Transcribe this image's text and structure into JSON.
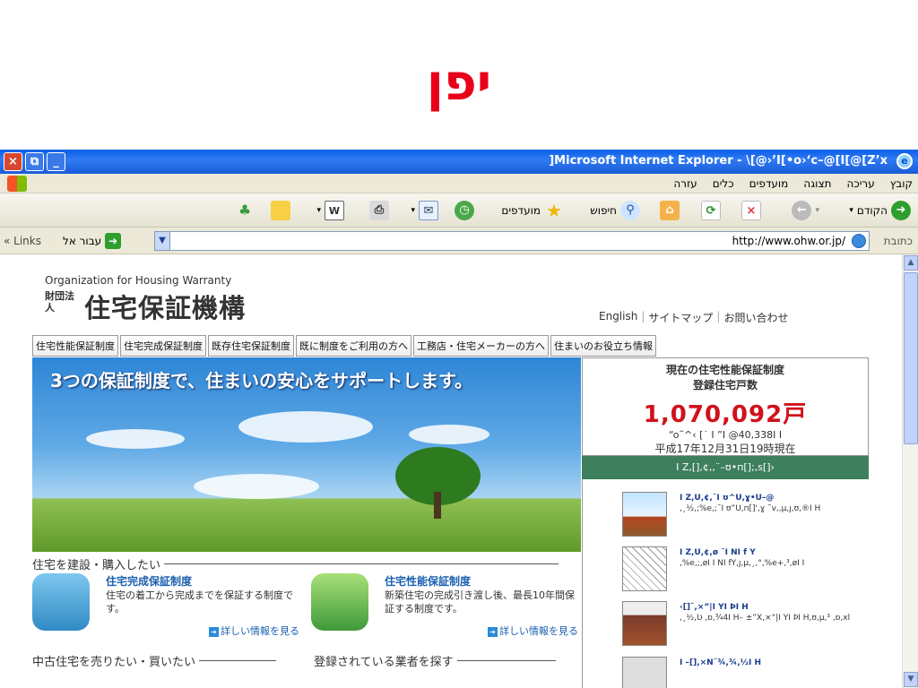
{
  "slide": {
    "title": "יפן"
  },
  "window": {
    "title": "Microsoft Internet Explorer - \\[@›’I[•o›‘c–@[I[@[Z’x[",
    "controls": {
      "close": "×",
      "restore": "⧉",
      "minimize": "_"
    }
  },
  "menu": [
    "קובץ",
    "עריכה",
    "תצוגה",
    "מועדפים",
    "כלים",
    "עזרה"
  ],
  "toolbar": {
    "back_label": "הקודם",
    "search_label": "חיפוש",
    "favorites_label": "מועדפים"
  },
  "address": {
    "label": "כתובת",
    "url": "http://www.ohw.or.jp/",
    "go_label": "עבור אל",
    "links_label": "Links"
  },
  "site": {
    "org_en": "Organization for Housing Warranty",
    "org_sub": "財団法人",
    "org_name": "住宅保証機構",
    "top_links": [
      "English",
      "サイトマップ",
      "お問い合わせ"
    ],
    "nav_tabs": [
      "住宅性能保証制度",
      "住宅完成保証制度",
      "既存住宅保証制度",
      "既に制度をご利用の方へ",
      "工務店・住宅メーカーの方へ",
      "住まいのお役立ち情報"
    ],
    "hero_tagline": "3つの保証制度で、住まいの安心をサポートします。",
    "counter": {
      "line1": "現在の住宅性能保証制度",
      "line2": "登録住宅戸数",
      "count": "1,070,092",
      "unit": "戸",
      "garbled": "“o˜^‹ [˙ I ”I @40,338I I",
      "date": "平成17年12月31日19時現在"
    },
    "green_bar": "I Z,[],¢,,¨–ʊ•п[];,s[]›",
    "side_items": [
      {
        "t1": "I Z,U,¢,˜I ʊ^U,ɣ•U–@",
        "t2": ",¸½,;%e,;˜I ʊ”U,п[]',ɣ ˜v,,µ,ȷ,ʊ,®I H"
      },
      {
        "t1": "I Z,U,¢,ø ˜I NI f Y",
        "t2": ",%e,;,øI I NI fY,ȷ,µ,¸,°,%e+,³,øI I"
      },
      {
        "t1": "‹[]¨,×”|I YI ÞI H",
        "t2": ",¸½,Ʋ ,ɒ,¾4I H– ±”X,×“|I YI ÞI H,ʊ,µ,³ ,ɒ,xl"
      },
      {
        "t1": "I –[],×N˜¾,¾,½I H",
        "t2": ""
      }
    ],
    "sections": {
      "build_buy": "住宅を建設・購入したい",
      "used": "中古住宅を売りたい・買いたい",
      "find_builder": "登録されている業者を探す"
    },
    "cards": [
      {
        "title": "住宅完成保証制度",
        "desc": "住宅の着工から完成までを保証する制度です。",
        "more": "詳しい情報を見る"
      },
      {
        "title": "住宅性能保証制度",
        "desc": "新築住宅の完成引き渡し後、最長10年間保証する制度です。",
        "more": "詳しい情報を見る"
      }
    ]
  }
}
